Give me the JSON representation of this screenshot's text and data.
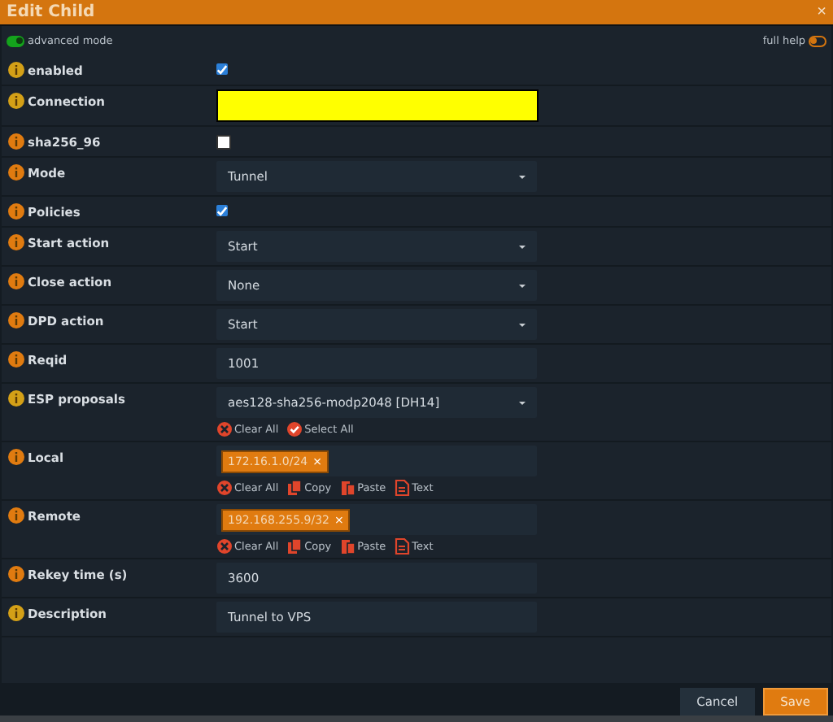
{
  "window": {
    "title": "Edit Child",
    "close": "×"
  },
  "toolbar": {
    "advanced_mode": {
      "label": "advanced mode",
      "on": true
    },
    "full_help": {
      "label": "full help",
      "on": false
    }
  },
  "fields": [
    {
      "label": "enabled",
      "color": "#d4a017",
      "kind": "checkbox",
      "checked": true
    },
    {
      "label": "Connection",
      "color": "#d4a017",
      "kind": "masked"
    },
    {
      "label": "sha256_96",
      "color": "#e07b10",
      "kind": "checkbox",
      "checked": false
    },
    {
      "label": "Mode",
      "color": "#e07b10",
      "kind": "select",
      "value": "Tunnel"
    },
    {
      "label": "Policies",
      "color": "#e07b10",
      "kind": "checkbox",
      "checked": true
    },
    {
      "label": "Start action",
      "color": "#e07b10",
      "kind": "select",
      "value": "Start"
    },
    {
      "label": "Close action",
      "color": "#e07b10",
      "kind": "select",
      "value": "None"
    },
    {
      "label": "DPD action",
      "color": "#e07b10",
      "kind": "select",
      "value": "Start"
    },
    {
      "label": "Reqid",
      "color": "#e07b10",
      "kind": "text",
      "value": "1001"
    },
    {
      "label": "ESP proposals",
      "color": "#d4a017",
      "kind": "select",
      "value": "aes128-sha256-modp2048 [DH14]",
      "actions": [
        {
          "kind": "clear",
          "label": "Clear All"
        },
        {
          "kind": "select",
          "label": "Select All"
        }
      ]
    },
    {
      "label": "Local",
      "color": "#e07b10",
      "kind": "tags",
      "tags": [
        {
          "label": "172.16.1.0/24",
          "remove": "×"
        }
      ],
      "actions": [
        {
          "kind": "clear",
          "label": "Clear All"
        },
        {
          "kind": "copy",
          "label": "Copy"
        },
        {
          "kind": "paste",
          "label": "Paste"
        },
        {
          "kind": "text",
          "label": "Text"
        }
      ]
    },
    {
      "label": "Remote",
      "color": "#e07b10",
      "kind": "tags",
      "tags": [
        {
          "label": "192.168.255.9/32",
          "remove": "×"
        }
      ],
      "actions": [
        {
          "kind": "clear",
          "label": "Clear All"
        },
        {
          "kind": "copy",
          "label": "Copy"
        },
        {
          "kind": "paste",
          "label": "Paste"
        },
        {
          "kind": "text",
          "label": "Text"
        }
      ]
    },
    {
      "label": "Rekey time (s)",
      "color": "#e07b10",
      "kind": "text",
      "value": "3600"
    },
    {
      "label": "Description",
      "color": "#d4a017",
      "kind": "text",
      "value": "Tunnel to VPS"
    }
  ],
  "buttons": [
    {
      "label": "Cancel",
      "kind": "secondary"
    },
    {
      "label": "Save",
      "kind": "primary"
    }
  ]
}
